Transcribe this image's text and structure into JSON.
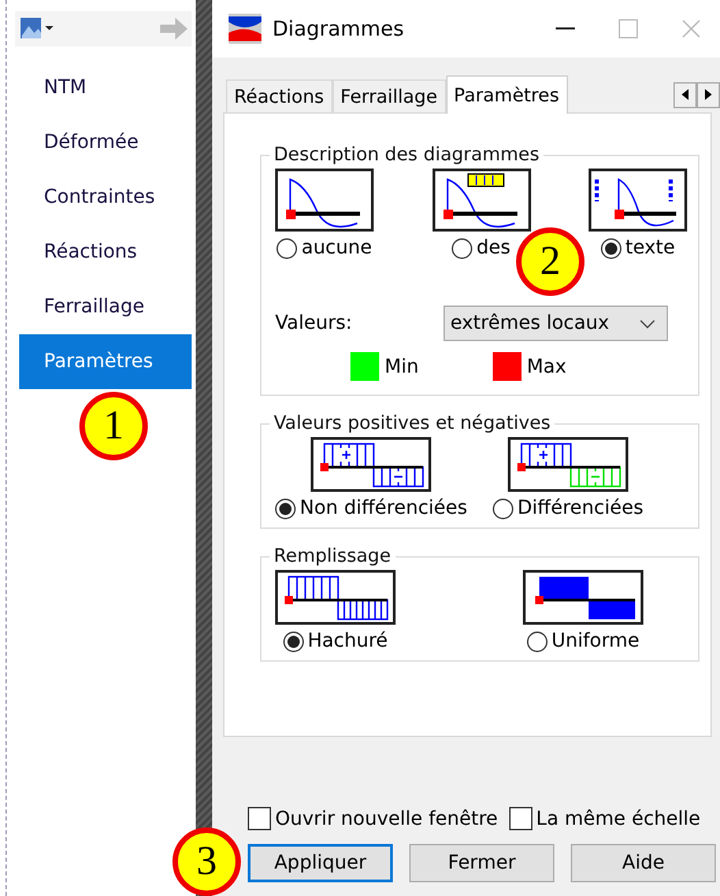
{
  "sidebar": {
    "items": [
      {
        "label": "NTM",
        "selected": false
      },
      {
        "label": "Déformée",
        "selected": false
      },
      {
        "label": "Contraintes",
        "selected": false
      },
      {
        "label": "Réactions",
        "selected": false
      },
      {
        "label": "Ferraillage",
        "selected": false
      },
      {
        "label": "Paramètres",
        "selected": true
      }
    ]
  },
  "window": {
    "title": "Diagrammes"
  },
  "tabs": [
    {
      "label": "Réactions",
      "selected": false
    },
    {
      "label": "Ferraillage",
      "selected": false
    },
    {
      "label": "Paramètres",
      "selected": true
    }
  ],
  "groups": [
    {
      "title": "Description des diagrammes",
      "options": [
        {
          "label": "aucune",
          "selected": false,
          "kind": "curve"
        },
        {
          "label": "des",
          "selected": false,
          "kind": "curve-label"
        },
        {
          "label": "texte",
          "selected": true,
          "kind": "curve-labels"
        }
      ],
      "values": {
        "label": "Valeurs:",
        "combo": "extrêmes locaux"
      },
      "legend": [
        {
          "label": "Min",
          "color": "#00ff00"
        },
        {
          "label": "Max",
          "color": "#ff0000"
        }
      ]
    },
    {
      "title": "Valeurs positives et négatives",
      "options": [
        {
          "label": "Non différenciées",
          "selected": true,
          "kind": "split-same"
        },
        {
          "label": "Différenciées",
          "selected": false,
          "kind": "split-diff"
        }
      ]
    },
    {
      "title": "Remplissage",
      "options": [
        {
          "label": "Hachuré",
          "selected": true,
          "kind": "hatched"
        },
        {
          "label": "Uniforme",
          "selected": false,
          "kind": "solid"
        }
      ]
    }
  ],
  "checkboxes": [
    {
      "label": "Ouvrir nouvelle fenêtre",
      "checked": false
    },
    {
      "label": "La même échelle",
      "checked": false
    }
  ],
  "buttons": [
    {
      "label": "Appliquer",
      "focused": true
    },
    {
      "label": "Fermer",
      "focused": false
    },
    {
      "label": "Aide",
      "focused": false
    }
  ],
  "callouts": [
    {
      "label": "1"
    },
    {
      "label": "2"
    },
    {
      "label": "3"
    }
  ]
}
